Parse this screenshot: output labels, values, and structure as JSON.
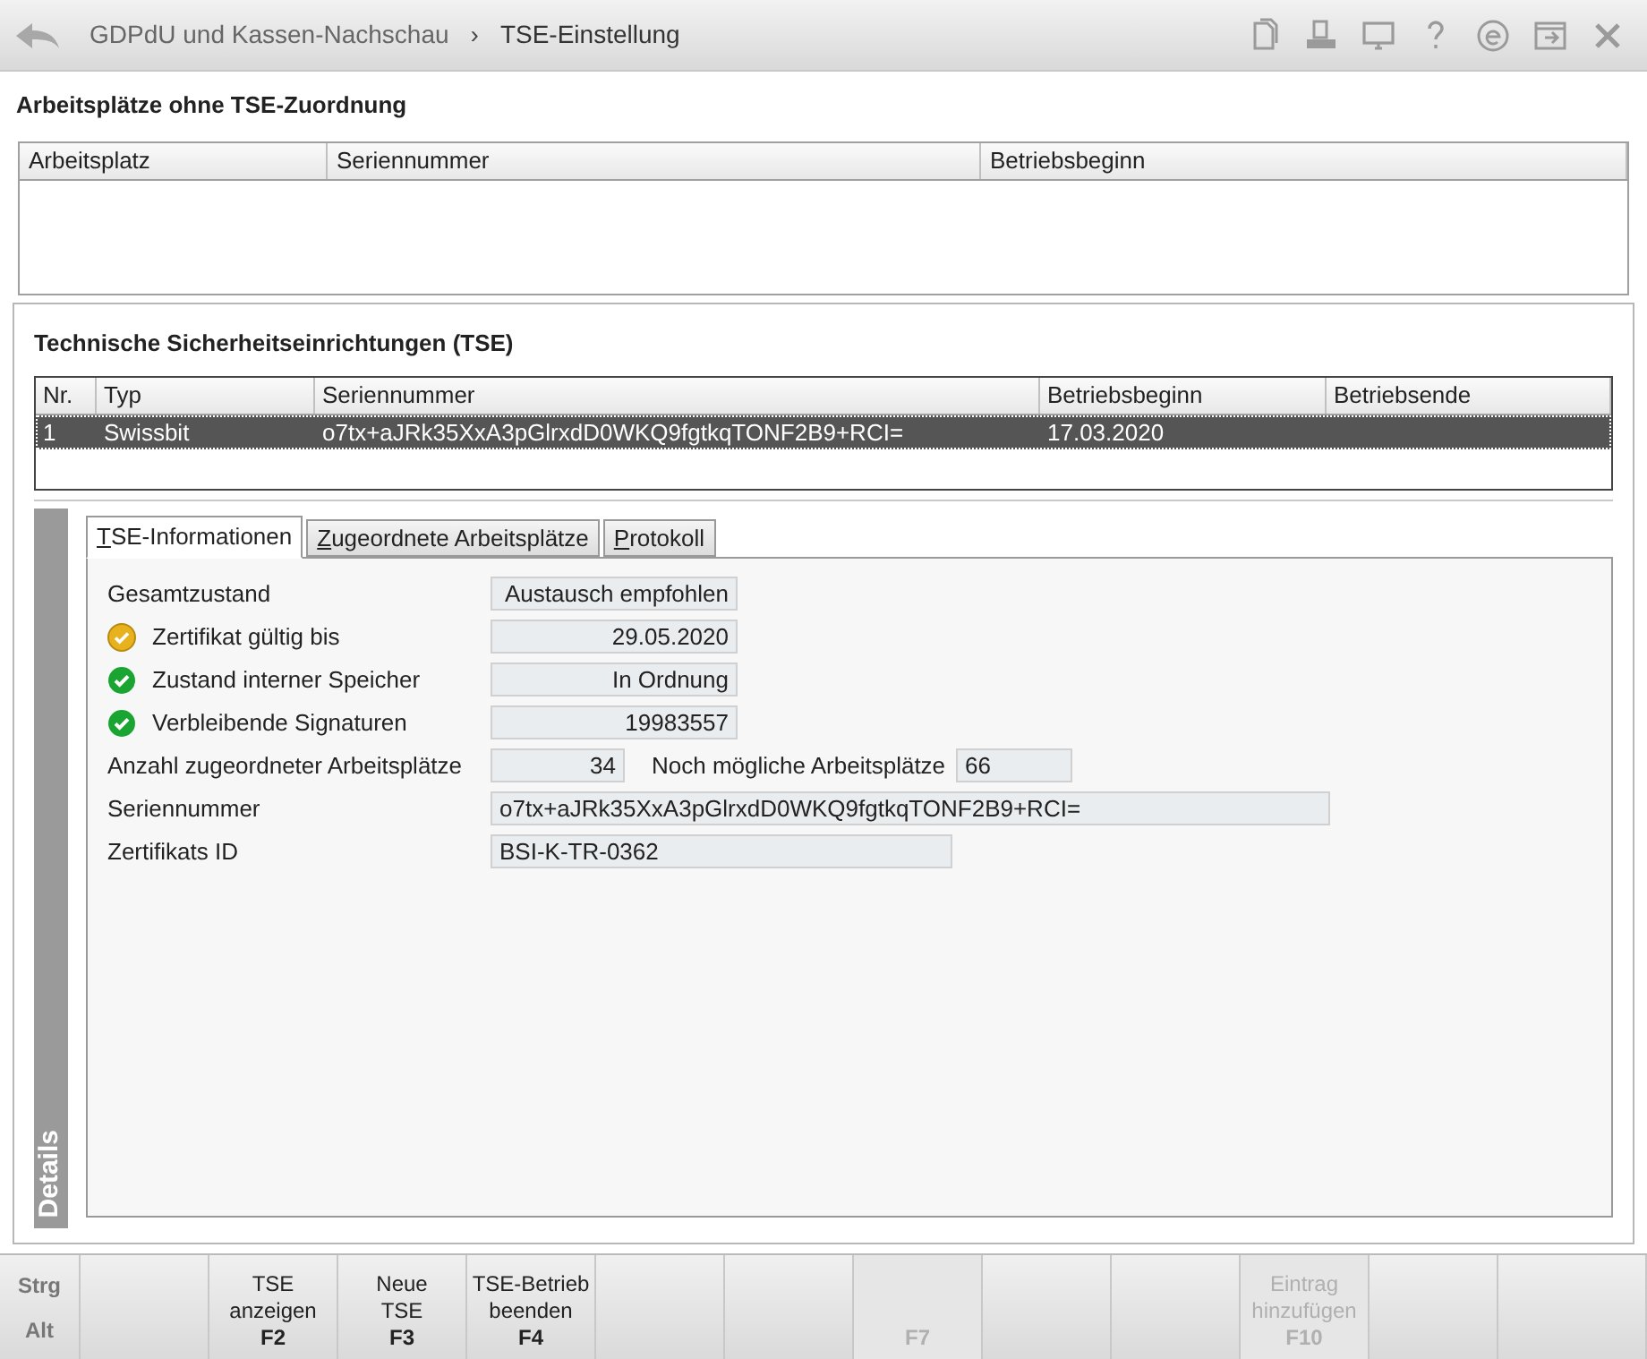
{
  "header": {
    "breadcrumb": [
      "GDPdU und Kassen-Nachschau",
      "TSE-Einstellung"
    ],
    "separator": "›"
  },
  "unassigned": {
    "title": "Arbeitsplätze ohne TSE-Zuordnung",
    "columns": [
      "Arbeitsplatz",
      "Seriennummer",
      "Betriebsbeginn"
    ]
  },
  "tse": {
    "title": "Technische Sicherheitseinrichtungen (TSE)",
    "columns": [
      "Nr.",
      "Typ",
      "Seriennummer",
      "Betriebsbeginn",
      "Betriebsende"
    ],
    "rows": [
      {
        "cells": [
          "1",
          "Swissbit",
          "o7tx+aJRk35XxA3pGlrxdD0WKQ9fgtkqTONF2B9+RCI=",
          "17.03.2020",
          ""
        ],
        "selected": true
      }
    ]
  },
  "details": {
    "label": "Details",
    "tabs": [
      {
        "label": "TSE-Informationen",
        "selected": true
      },
      {
        "label": "Zugeordnete Arbeitsplätze",
        "selected": false
      },
      {
        "label": "Protokoll",
        "selected": false
      }
    ],
    "fields": [
      {
        "label": "Gesamtzustand",
        "value": "Austausch empfohlen",
        "kind": "plain"
      },
      {
        "label": "Zertifikat gültig bis",
        "value": "29.05.2020",
        "kind": "warning"
      },
      {
        "label": "Zustand interner Speicher",
        "value": "In Ordnung",
        "kind": "ok"
      },
      {
        "label": "Verbleibende Signaturen",
        "value": "19983557",
        "kind": "ok"
      }
    ],
    "count": {
      "label": "Anzahl zugeordneter Arbeitsplätze",
      "value": "34",
      "extra_label": "Noch mögliche Arbeitsplätze",
      "extra_value": "66"
    },
    "serial": {
      "label": "Seriennummer",
      "value": "o7tx+aJRk35XxA3pGlrxdD0WKQ9fgtkqTONF2B9+RCI="
    },
    "cert": {
      "label": "Zertifikats ID",
      "value": "BSI-K-TR-0362"
    }
  },
  "fkeys": {
    "modifiers": [
      "Strg",
      "Alt"
    ],
    "keys": [
      {
        "disabled": false
      },
      {
        "label_lines": [
          "TSE",
          "anzeigen"
        ],
        "key": "F2",
        "disabled": false
      },
      {
        "label_lines": [
          "Neue",
          "TSE"
        ],
        "key": "F3",
        "disabled": false
      },
      {
        "label_lines": [
          "TSE-Betrieb",
          "beenden"
        ],
        "key": "F4",
        "disabled": false
      },
      {
        "disabled": false
      },
      {
        "disabled": false
      },
      {
        "key": "F7",
        "disabled": true
      },
      {
        "disabled": false
      },
      {
        "disabled": false
      },
      {
        "label_lines": [
          "Eintrag",
          "hinzufügen"
        ],
        "key": "F10",
        "disabled": true
      },
      {
        "disabled": false
      },
      {
        "disabled": false
      }
    ]
  }
}
